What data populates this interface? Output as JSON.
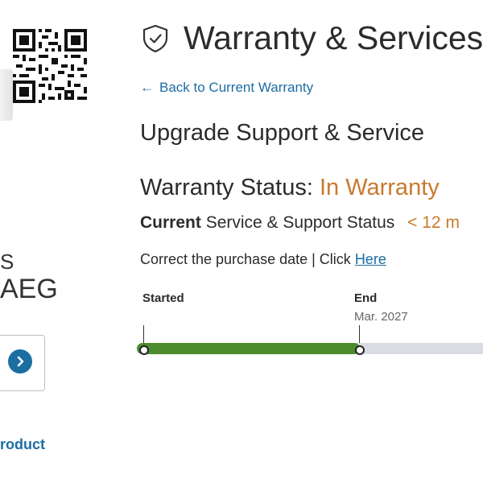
{
  "left": {
    "model_line_1": "S",
    "model_line_2": "AEG",
    "product_link": "roduct"
  },
  "header": {
    "title": "Warranty & Services"
  },
  "nav": {
    "back_label": "Back to Current Warranty"
  },
  "main": {
    "subtitle": "Upgrade Support & Service",
    "warranty_status_label": "Warranty Status:",
    "warranty_status_value": "In Warranty",
    "current_bold": "Current",
    "current_rest": "Service & Support Status",
    "current_value": "< 12 m",
    "correct_text": "Correct the purchase date | Click",
    "here_link": "Here"
  },
  "timeline": {
    "start_label": "Started",
    "end_label": "End",
    "end_date": "Mar. 2027",
    "progress_fraction": 0.63
  },
  "colors": {
    "accent_link": "#1c6da4",
    "status_orange": "#c87a2d",
    "progress_green": "#4c8c2e",
    "track_grey": "#d9dde3"
  }
}
